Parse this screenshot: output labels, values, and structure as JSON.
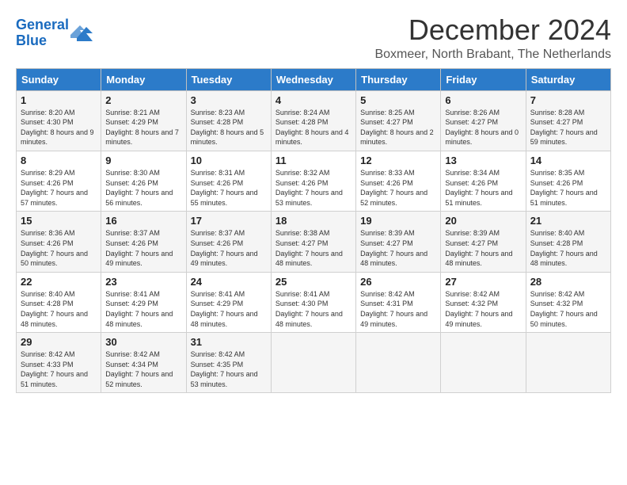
{
  "logo": {
    "line1": "General",
    "line2": "Blue"
  },
  "title": "December 2024",
  "subtitle": "Boxmeer, North Brabant, The Netherlands",
  "headers": [
    "Sunday",
    "Monday",
    "Tuesday",
    "Wednesday",
    "Thursday",
    "Friday",
    "Saturday"
  ],
  "weeks": [
    [
      {
        "day": "1",
        "sunrise": "8:20 AM",
        "sunset": "4:30 PM",
        "daylight": "8 hours and 9 minutes."
      },
      {
        "day": "2",
        "sunrise": "8:21 AM",
        "sunset": "4:29 PM",
        "daylight": "8 hours and 7 minutes."
      },
      {
        "day": "3",
        "sunrise": "8:23 AM",
        "sunset": "4:28 PM",
        "daylight": "8 hours and 5 minutes."
      },
      {
        "day": "4",
        "sunrise": "8:24 AM",
        "sunset": "4:28 PM",
        "daylight": "8 hours and 4 minutes."
      },
      {
        "day": "5",
        "sunrise": "8:25 AM",
        "sunset": "4:27 PM",
        "daylight": "8 hours and 2 minutes."
      },
      {
        "day": "6",
        "sunrise": "8:26 AM",
        "sunset": "4:27 PM",
        "daylight": "8 hours and 0 minutes."
      },
      {
        "day": "7",
        "sunrise": "8:28 AM",
        "sunset": "4:27 PM",
        "daylight": "7 hours and 59 minutes."
      }
    ],
    [
      {
        "day": "8",
        "sunrise": "8:29 AM",
        "sunset": "4:26 PM",
        "daylight": "7 hours and 57 minutes."
      },
      {
        "day": "9",
        "sunrise": "8:30 AM",
        "sunset": "4:26 PM",
        "daylight": "7 hours and 56 minutes."
      },
      {
        "day": "10",
        "sunrise": "8:31 AM",
        "sunset": "4:26 PM",
        "daylight": "7 hours and 55 minutes."
      },
      {
        "day": "11",
        "sunrise": "8:32 AM",
        "sunset": "4:26 PM",
        "daylight": "7 hours and 53 minutes."
      },
      {
        "day": "12",
        "sunrise": "8:33 AM",
        "sunset": "4:26 PM",
        "daylight": "7 hours and 52 minutes."
      },
      {
        "day": "13",
        "sunrise": "8:34 AM",
        "sunset": "4:26 PM",
        "daylight": "7 hours and 51 minutes."
      },
      {
        "day": "14",
        "sunrise": "8:35 AM",
        "sunset": "4:26 PM",
        "daylight": "7 hours and 51 minutes."
      }
    ],
    [
      {
        "day": "15",
        "sunrise": "8:36 AM",
        "sunset": "4:26 PM",
        "daylight": "7 hours and 50 minutes."
      },
      {
        "day": "16",
        "sunrise": "8:37 AM",
        "sunset": "4:26 PM",
        "daylight": "7 hours and 49 minutes."
      },
      {
        "day": "17",
        "sunrise": "8:37 AM",
        "sunset": "4:26 PM",
        "daylight": "7 hours and 49 minutes."
      },
      {
        "day": "18",
        "sunrise": "8:38 AM",
        "sunset": "4:27 PM",
        "daylight": "7 hours and 48 minutes."
      },
      {
        "day": "19",
        "sunrise": "8:39 AM",
        "sunset": "4:27 PM",
        "daylight": "7 hours and 48 minutes."
      },
      {
        "day": "20",
        "sunrise": "8:39 AM",
        "sunset": "4:27 PM",
        "daylight": "7 hours and 48 minutes."
      },
      {
        "day": "21",
        "sunrise": "8:40 AM",
        "sunset": "4:28 PM",
        "daylight": "7 hours and 48 minutes."
      }
    ],
    [
      {
        "day": "22",
        "sunrise": "8:40 AM",
        "sunset": "4:28 PM",
        "daylight": "7 hours and 48 minutes."
      },
      {
        "day": "23",
        "sunrise": "8:41 AM",
        "sunset": "4:29 PM",
        "daylight": "7 hours and 48 minutes."
      },
      {
        "day": "24",
        "sunrise": "8:41 AM",
        "sunset": "4:29 PM",
        "daylight": "7 hours and 48 minutes."
      },
      {
        "day": "25",
        "sunrise": "8:41 AM",
        "sunset": "4:30 PM",
        "daylight": "7 hours and 48 minutes."
      },
      {
        "day": "26",
        "sunrise": "8:42 AM",
        "sunset": "4:31 PM",
        "daylight": "7 hours and 49 minutes."
      },
      {
        "day": "27",
        "sunrise": "8:42 AM",
        "sunset": "4:32 PM",
        "daylight": "7 hours and 49 minutes."
      },
      {
        "day": "28",
        "sunrise": "8:42 AM",
        "sunset": "4:32 PM",
        "daylight": "7 hours and 50 minutes."
      }
    ],
    [
      {
        "day": "29",
        "sunrise": "8:42 AM",
        "sunset": "4:33 PM",
        "daylight": "7 hours and 51 minutes."
      },
      {
        "day": "30",
        "sunrise": "8:42 AM",
        "sunset": "4:34 PM",
        "daylight": "7 hours and 52 minutes."
      },
      {
        "day": "31",
        "sunrise": "8:42 AM",
        "sunset": "4:35 PM",
        "daylight": "7 hours and 53 minutes."
      },
      null,
      null,
      null,
      null
    ]
  ],
  "labels": {
    "sunrise": "Sunrise:",
    "sunset": "Sunset:",
    "daylight": "Daylight:"
  }
}
